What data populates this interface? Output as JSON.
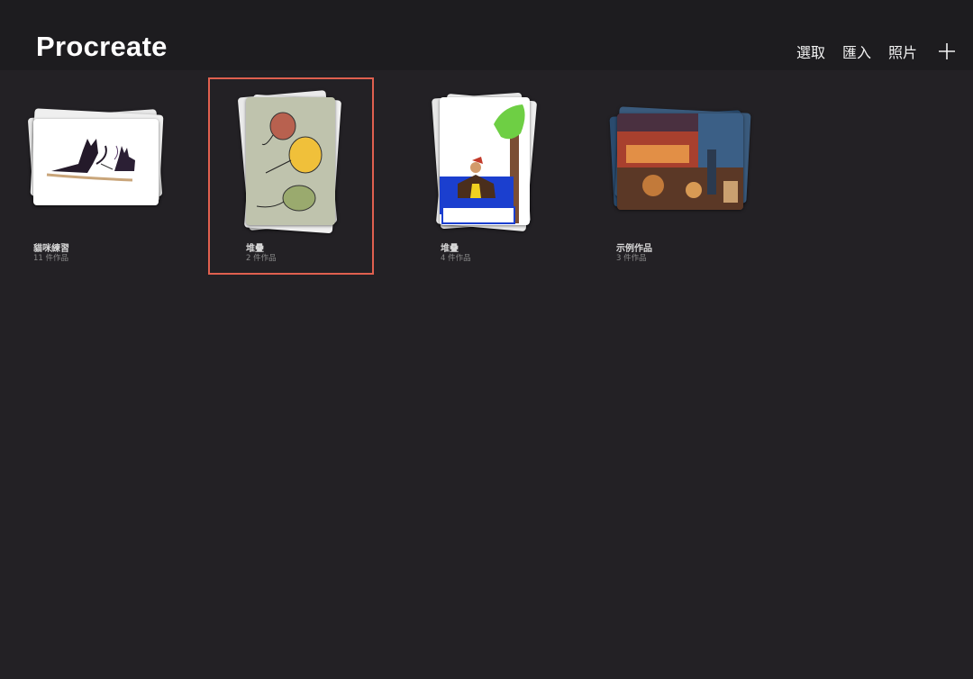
{
  "header": {
    "title": "Procreate",
    "actions": {
      "select": "選取",
      "import": "匯入",
      "photo": "照片"
    },
    "add_icon": "plus-icon"
  },
  "gallery": {
    "stacks": [
      {
        "name": "貓咪練習",
        "count": "11 件作品",
        "thumb": "cats-sketch"
      },
      {
        "name": "堆疊",
        "count": "2 件作品",
        "thumb": "balloons-sketch",
        "selected": true
      },
      {
        "name": "堆疊",
        "count": "4 件作品",
        "thumb": "girl-tree-sketch"
      },
      {
        "name": "示例作品",
        "count": "3 件作品",
        "thumb": "night-market-painting"
      }
    ]
  },
  "colors": {
    "background": "#232125",
    "header": "#1d1c1f",
    "highlight": "#e0604f"
  }
}
